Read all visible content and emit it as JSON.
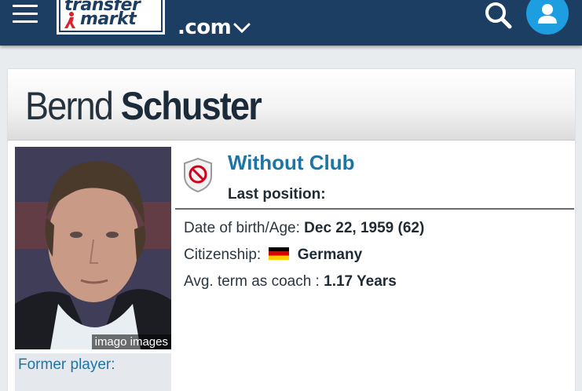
{
  "header": {
    "logo_top": "transfer",
    "logo_bottom": "markt",
    "domain": ".com",
    "icons": {
      "menu": "hamburger-icon",
      "dropdown": "chevron-down-icon",
      "search": "search-icon",
      "account": "user-icon"
    },
    "colors": {
      "bar": "#1c3e63",
      "account": "#1d9ee0"
    }
  },
  "profile": {
    "first_name": "Bernd",
    "last_name": "Schuster",
    "photo_credit": "imago images",
    "former_player_label": "Former player:",
    "club": "Without Club",
    "status_icon": "no-entry-icon",
    "last_position_label": "Last position:",
    "dob_label": "Date of birth/Age:",
    "dob_value": "Dec 22, 1959 (62)",
    "citizenship_label": "Citizenship:",
    "citizenship_value": "Germany",
    "term_label": "Avg. term as coach :",
    "term_value": "1.17 Years",
    "colors": {
      "link": "#1d75a6"
    }
  }
}
